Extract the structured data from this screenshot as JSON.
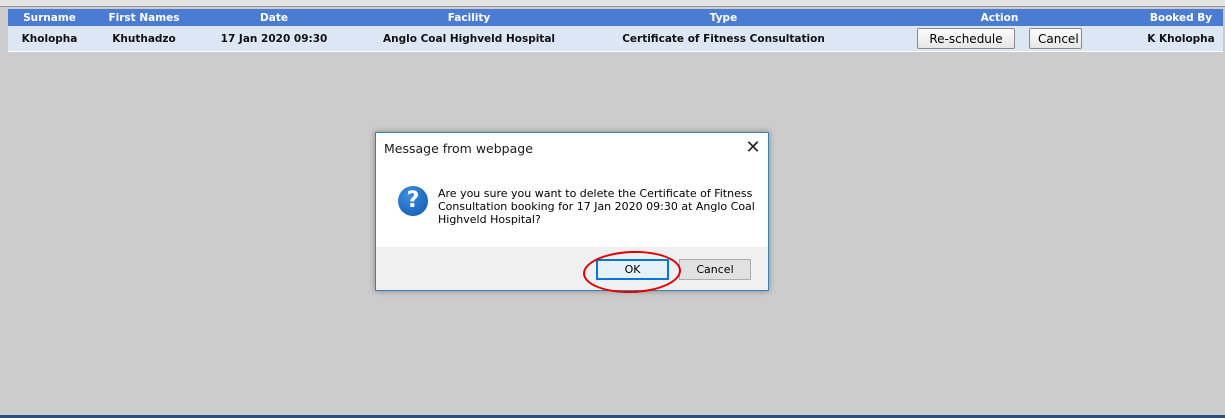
{
  "grid": {
    "headers": {
      "surname": "Surname",
      "first_names": "First Names",
      "date": "Date",
      "facility": "Facility",
      "type": "Type",
      "action": "Action",
      "booked_by": "Booked By"
    },
    "row": {
      "surname": "Kholopha",
      "first_names": "Khuthadzo",
      "date": "17 Jan 2020 09:30",
      "facility": "Anglo Coal Highveld Hospital",
      "type": "Certificate of Fitness Consultation",
      "reschedule_label": "Re-schedule",
      "cancel_label": "Cancel",
      "booked_by": "K Kholopha"
    }
  },
  "dialog": {
    "title": "Message from webpage",
    "close_glyph": "✕",
    "icon_glyph": "?",
    "icon": "question-icon",
    "message": "Are you sure you want to delete the Certificate of Fitness Consultation booking for 17 Jan 2020 09:30 at Anglo Coal Highveld Hospital?",
    "ok_label": "OK",
    "cancel_label": "Cancel"
  },
  "colors": {
    "header_bg": "#4a7cd4",
    "row_bg": "#dce6f4",
    "page_bg": "#cccccc",
    "annotation": "#e00000"
  }
}
